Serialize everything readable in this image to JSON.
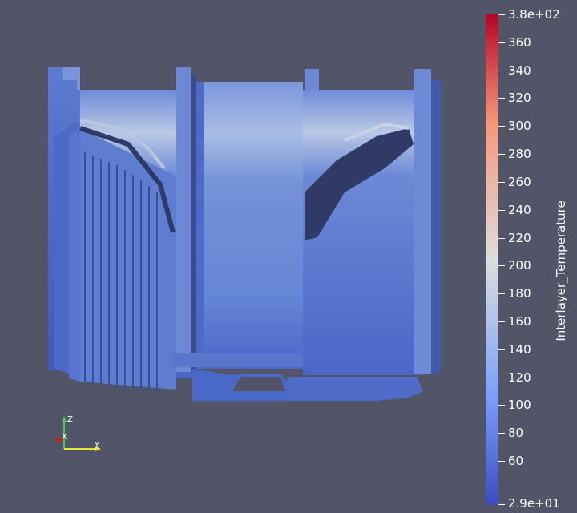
{
  "colorbar": {
    "title": "Interlayer_Temperature",
    "max_label": "3.8e+02",
    "min_label": "2.9e+01",
    "min_value": 29,
    "max_value": 380,
    "ticks": [
      "360",
      "340",
      "320",
      "300",
      "280",
      "260",
      "240",
      "220",
      "200",
      "180",
      "160",
      "140",
      "120",
      "100",
      "80",
      "60"
    ],
    "colors": {
      "low": "#3b4cc0",
      "mid": "#dddddd",
      "high": "#b40426"
    }
  },
  "axes": {
    "z_label": "Z",
    "x_label": "X",
    "y_label": "Y",
    "colors": {
      "z": "#3fd13f",
      "x": "#e03030",
      "y": "#e8e83a"
    }
  },
  "scene": {
    "background": "#525568",
    "surface_color": "#6585d6"
  }
}
